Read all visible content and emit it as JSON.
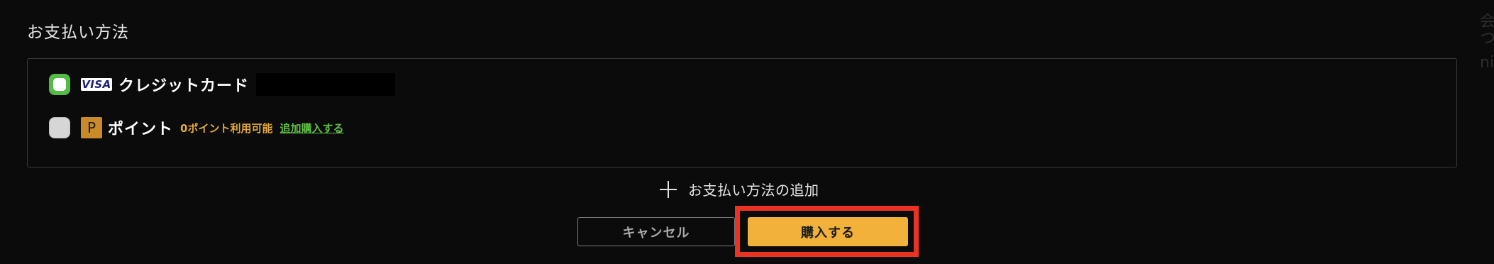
{
  "section": {
    "title": "お支払い方法"
  },
  "methods": {
    "card": {
      "brand": "VISA",
      "label": "クレジットカード"
    },
    "point": {
      "badge": "P",
      "label": "ポイント",
      "available": "0ポイント利用可能",
      "link": "追加購入する"
    }
  },
  "add_method": {
    "label": "お支払い方法の追加"
  },
  "buttons": {
    "cancel": "キャンセル",
    "purchase": "購入する"
  },
  "right_edge": {
    "t1": "会",
    "t2": "つ",
    "t3": "ni"
  },
  "colors": {
    "background": "#0b0b0b",
    "accent_orange": "#f1b13b",
    "radio_selected": "#57b947",
    "highlight_red": "#ea3323",
    "link_green": "#5fbf47"
  }
}
